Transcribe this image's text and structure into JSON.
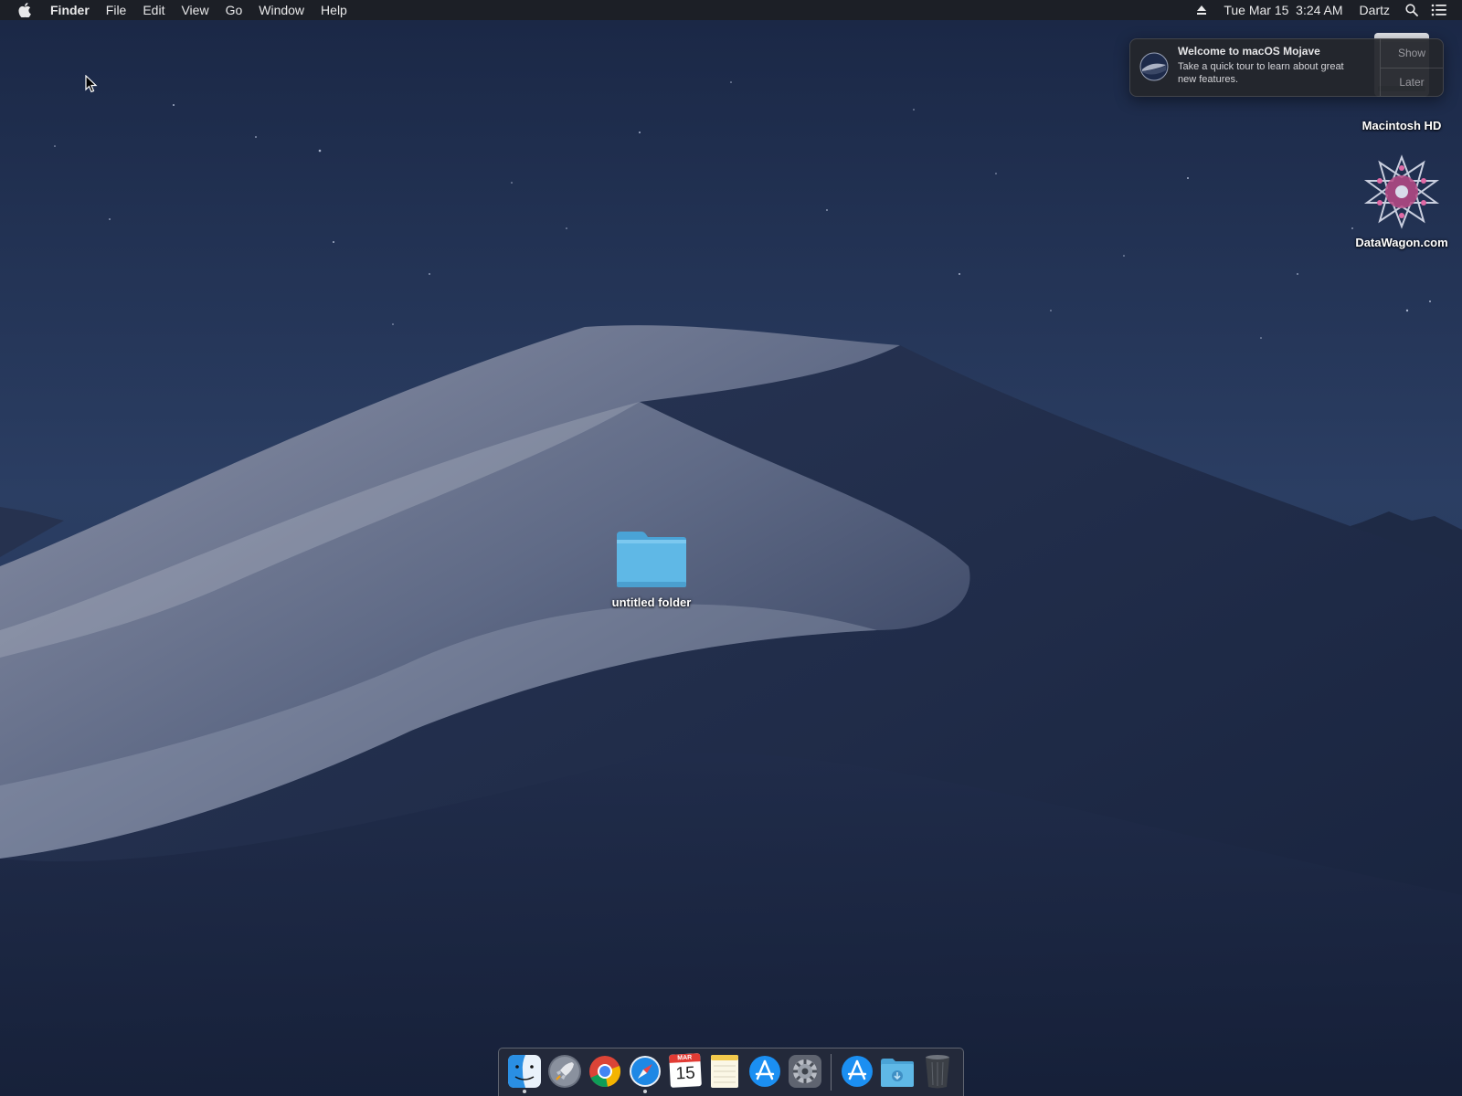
{
  "menubar": {
    "app_name": "Finder",
    "menus": [
      "File",
      "Edit",
      "View",
      "Go",
      "Window",
      "Help"
    ],
    "datetime": "Tue Mar 15  3:24 AM",
    "user": "Dartz"
  },
  "notification": {
    "title": "Welcome to macOS Mojave",
    "text_line1": "Take a quick tour to learn about great",
    "text_line2": "new features.",
    "show_label": "Show",
    "later_label": "Later"
  },
  "desktop": {
    "macintosh_hd_label": "Macintosh HD",
    "datawagon_label": "DataWagon.com",
    "folder_label": "untitled folder"
  },
  "dock": {
    "calendar_month": "MAR",
    "calendar_day": "15"
  },
  "colors": {
    "folder": "#5fb8e6",
    "sky": "#1c2a4a",
    "accent_blue": "#1e88e5"
  }
}
